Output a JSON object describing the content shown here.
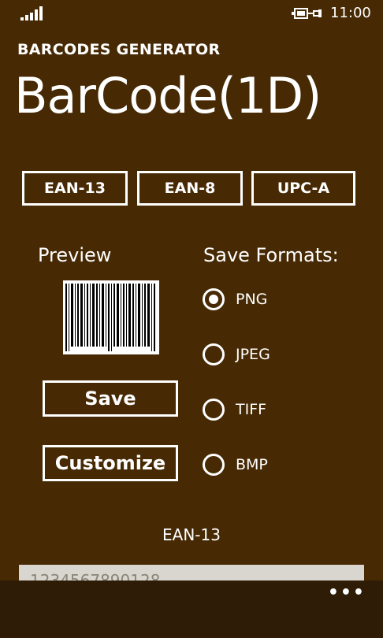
{
  "status": {
    "time": "11:00"
  },
  "header": {
    "app_title": "BARCODES GENERATOR",
    "page_title": "BarCode(1D)"
  },
  "barcode_types": [
    {
      "label": "EAN-13"
    },
    {
      "label": "EAN-8"
    },
    {
      "label": "UPC-A"
    }
  ],
  "preview": {
    "label": "Preview"
  },
  "actions": {
    "save": "Save",
    "customize": "Customize"
  },
  "save_formats": {
    "label": "Save Formats:",
    "options": [
      {
        "label": "PNG",
        "selected": true
      },
      {
        "label": "JPEG",
        "selected": false
      },
      {
        "label": "TIFF",
        "selected": false
      },
      {
        "label": "BMP",
        "selected": false
      }
    ]
  },
  "code": {
    "type_label": "EAN-13",
    "value": "1234567890128"
  },
  "app_bar": {
    "more": "•••"
  },
  "colors": {
    "background": "#472a04",
    "app_bar": "#2e1c06",
    "foreground": "#ffffff",
    "input_bg": "#d9d6cf"
  }
}
